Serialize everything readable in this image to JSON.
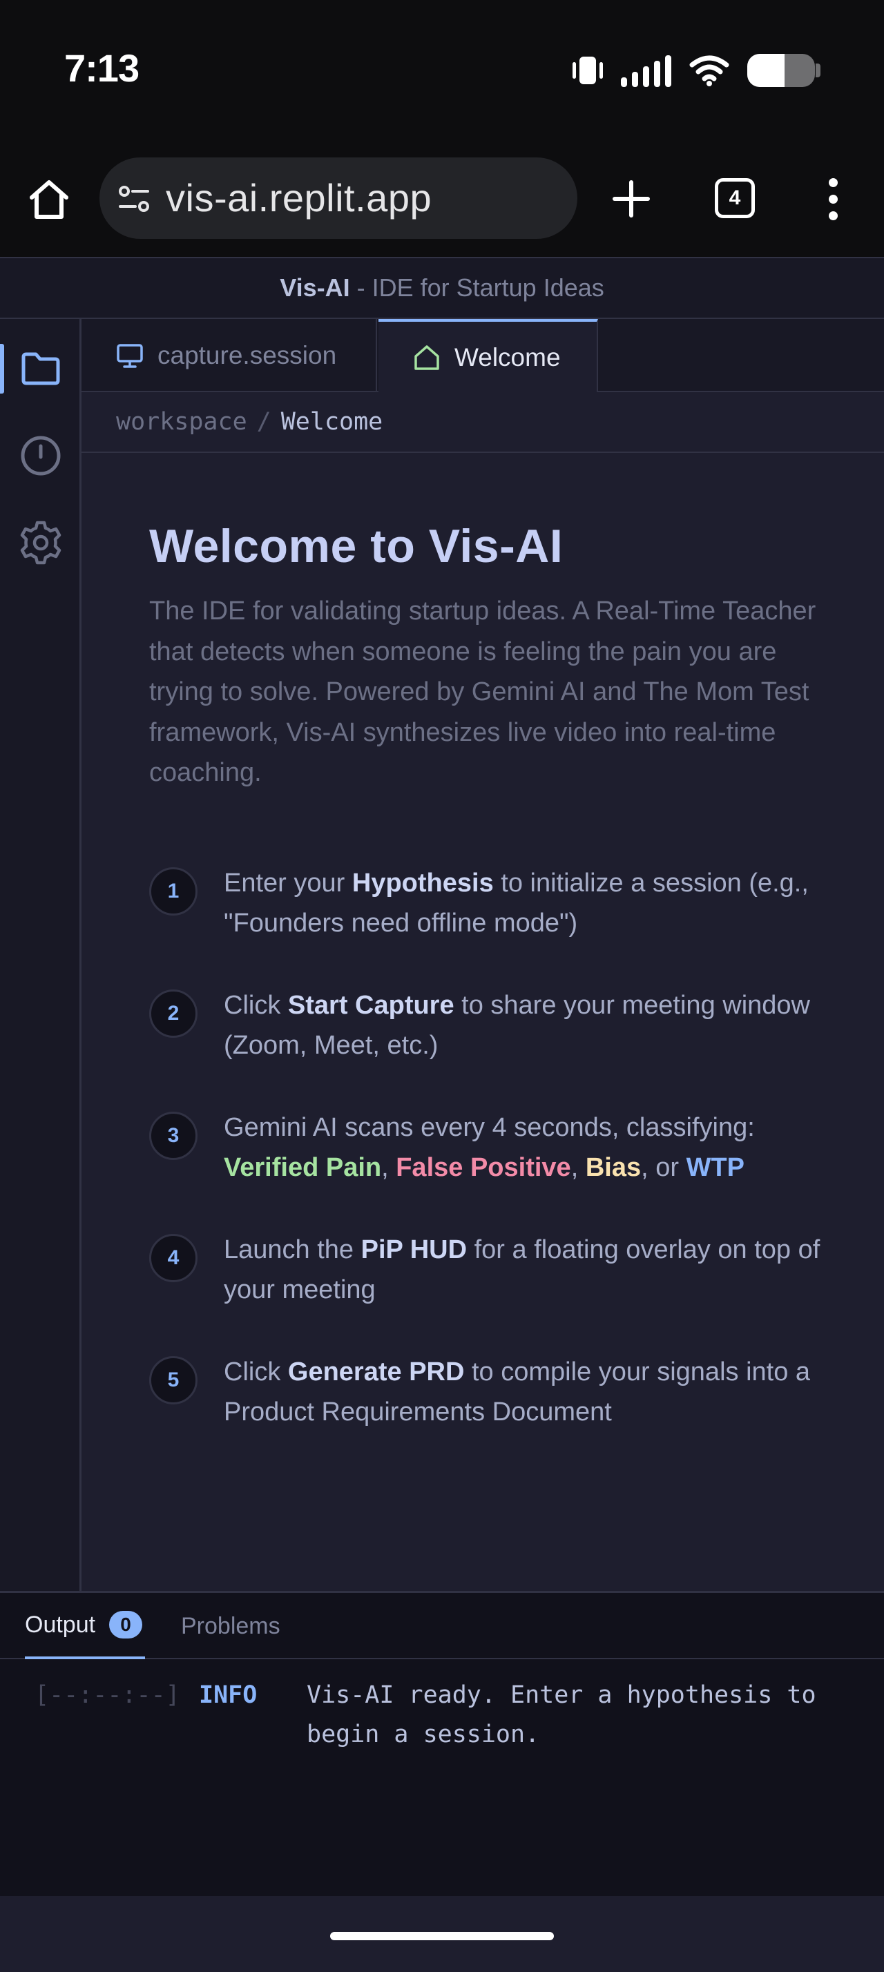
{
  "status_bar": {
    "time": "7:13",
    "battery_level_percent": 55,
    "icons": [
      "vibrate-icon",
      "cellular-signal-icon",
      "wifi-icon",
      "battery-icon"
    ]
  },
  "browser": {
    "url": "vis-ai.replit.app",
    "tab_count": "4",
    "icons": [
      "home-icon",
      "site-settings-icon",
      "new-tab-icon",
      "tab-switcher-icon",
      "more-menu-icon"
    ]
  },
  "app": {
    "brand": "Vis-AI",
    "tagline": " - IDE for Startup Ideas"
  },
  "activity_bar": {
    "items": [
      {
        "name": "explorer",
        "icon": "folder-icon",
        "active": true
      },
      {
        "name": "history",
        "icon": "clock-icon",
        "active": false
      },
      {
        "name": "settings",
        "icon": "gear-icon",
        "active": false
      }
    ]
  },
  "tabs": [
    {
      "label": "capture.session",
      "icon": "monitor-icon",
      "active": false
    },
    {
      "label": "Welcome",
      "icon": "home-icon",
      "active": true
    }
  ],
  "breadcrumb": {
    "root": "workspace",
    "separator": "/",
    "leaf": "Welcome"
  },
  "welcome": {
    "title": "Welcome to Vis-AI",
    "description": "The IDE for validating startup ideas. A Real-Time Teacher that detects when someone is feeling the pain you are trying to solve. Powered by Gemini AI and The Mom Test framework, Vis-AI synthesizes live video into real-time coaching.",
    "steps": [
      {
        "number": "1",
        "pre": "Enter your ",
        "bold": "Hypothesis",
        "post": " to initialize a session (e.g., \"Founders need offline mode\")"
      },
      {
        "number": "2",
        "pre": "Click ",
        "bold": "Start Capture",
        "post": " to share your meeting window (Zoom, Meet, etc.)"
      },
      {
        "number": "3",
        "pre": "Gemini AI scans every 4 seconds, classifying: ",
        "tag1": "Verified Pain",
        "sep1": ", ",
        "tag2": "False Positive",
        "sep2": ", ",
        "tag3": "Bias",
        "sep3": ", or ",
        "tag4": "WTP"
      },
      {
        "number": "4",
        "pre": "Launch the ",
        "bold": "PiP HUD",
        "post": " for a floating overlay on top of your meeting"
      },
      {
        "number": "5",
        "pre": "Click ",
        "bold": "Generate PRD",
        "post": " to compile your signals into a Product Requirements Document"
      }
    ]
  },
  "panel": {
    "tabs": [
      {
        "label": "Output",
        "badge": "0",
        "active": true
      },
      {
        "label": "Problems",
        "active": false
      }
    ],
    "log": {
      "timestamp": "[--:--:--]",
      "level": "INFO",
      "message": "Vis-AI ready. Enter a hypothesis to begin a session."
    }
  },
  "colors": {
    "accent": "#89b4fa",
    "verified_pain": "#a6e3a1",
    "false_positive": "#f38ba8",
    "bias": "#f9e2af",
    "wtp": "#89b4fa",
    "background": "#1e1e2e"
  }
}
